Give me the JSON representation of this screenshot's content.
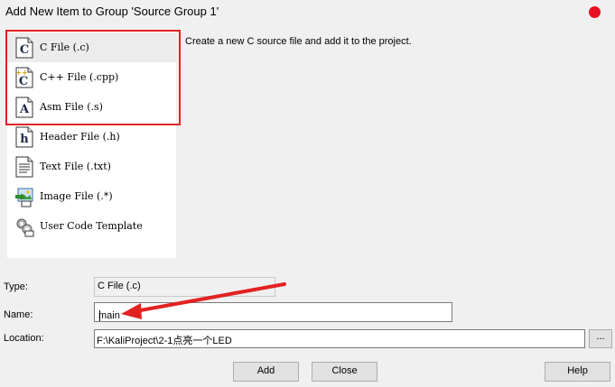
{
  "window": {
    "title": "Add New Item to Group 'Source Group 1'"
  },
  "items": [
    {
      "label": "C File (.c)",
      "icon": "c-file-icon"
    },
    {
      "label": "C++ File (.cpp)",
      "icon": "cpp-file-icon"
    },
    {
      "label": "Asm File (.s)",
      "icon": "asm-file-icon"
    },
    {
      "label": "Header File (.h)",
      "icon": "header-file-icon"
    },
    {
      "label": "Text File (.txt)",
      "icon": "text-file-icon"
    },
    {
      "label": "Image File (.*)",
      "icon": "image-file-icon"
    },
    {
      "label": "User Code Template",
      "icon": "template-icon"
    }
  ],
  "description": "Create a new C source file and add it to the project.",
  "form": {
    "type_label": "Type:",
    "type_value": "C File (.c)",
    "name_label": "Name:",
    "name_value": "main",
    "location_label": "Location:",
    "location_value": "F:\\KaliProject\\2-1点亮一个LED",
    "browse_label": "..."
  },
  "buttons": {
    "add": "Add",
    "close": "Close",
    "help": "Help"
  },
  "annotation": {
    "highlight_color": "#e32222",
    "arrow_color": "#e32222"
  }
}
